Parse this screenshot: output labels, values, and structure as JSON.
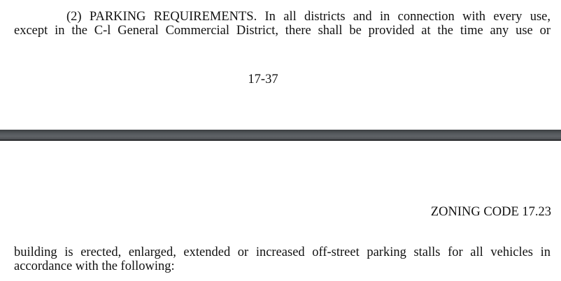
{
  "page_top": {
    "paragraph_line_1": "(2)    PARKING REQUIREMENTS. In all districts and in connection with every use,",
    "paragraph_line_2": "except in the C-l General Commercial District, there shall be provided at the time any use or",
    "page_number": "17-37"
  },
  "page_bottom": {
    "running_header": "ZONING CODE 17.23",
    "continued_line_1": "building is erected, enlarged, extended or increased off-street parking stalls for all vehicles in",
    "continued_line_2": "accordance with the following:"
  }
}
